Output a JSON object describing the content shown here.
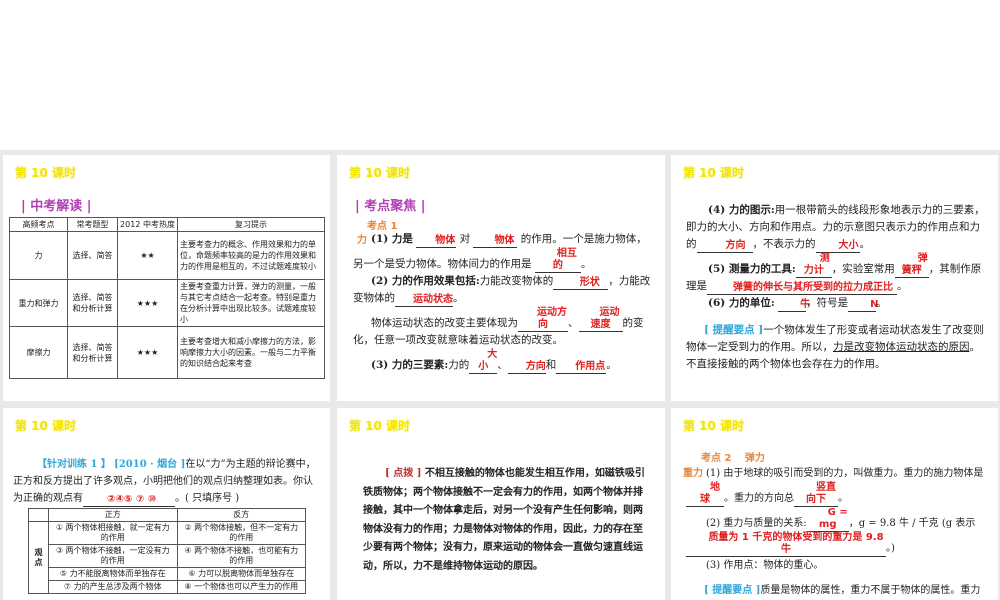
{
  "lesson_title": "第 10 课时",
  "slide1": {
    "section": "| 中考解读 |",
    "headers": [
      "高频考点",
      "常考题型",
      "2012 中考热度",
      "复习提示"
    ],
    "rows": [
      [
        "力",
        "选择、简答",
        "★★",
        "主要考查力的概念、作用效果和力的单位，命题频率较高的是力的作用效果和力的作用是相互的，不过试题难度较小"
      ],
      [
        "重力和弹力",
        "选择、简答和分析计算",
        "★★★",
        "主要考查重力计算，弹力的测量，一般与其它考点结合一起考查。特别是重力在分析计算中出现比较多。试题难度较小"
      ],
      [
        "摩擦力",
        "选择、简答和分析计算",
        "★★★",
        "主要考查增大和减小摩擦力的方法，影响摩擦力大小的因素。一般与二力平衡的知识结合起来考查"
      ]
    ]
  },
  "slide2": {
    "section": "| 考点聚焦 |",
    "point": "考点 1",
    "point_tag": "力",
    "p1a": "(1) 力是",
    "a1": "物体",
    "p1b": "对",
    "a2": "物体",
    "p1c": "的作用。一个是施力物体，另一个是受力物体。物体间力的作用是",
    "a3": "相互的",
    "end": "。",
    "p2a": "(2) 力的作用效果包括:",
    "p2b": "力能改变物体的",
    "a4": "形状",
    "p2c": "，力能改变物体的",
    "a5": "运动状态",
    "p3a": "物体运动状态的改变主要体现为",
    "a6": "运动方向",
    "sep": "、",
    "a7": "运动速度",
    "p3b": "的变化，任意一项改变就意味着运动状态的改变。",
    "p4a": "(3) 力的三要素:",
    "p4b": "力的",
    "a8": "大小",
    "a9": "方向",
    "p4c": "和",
    "a10": "作用点"
  },
  "slide3": {
    "p1a": "(4) 力的图示:",
    "p1b": "用一根带箭头的线段形象地表示力的三要素，即力的大小、方向和作用点。力的示意图只表示力的作用点和力的",
    "a1": "方向",
    "p1c": "，不表示力的",
    "a2": "大小",
    "p2a": "(5) 测量力的工具:",
    "a3": "测力计",
    "p2b": "，实验室常用",
    "a4": "弹簧秤",
    "p2c": "，其制作原理是",
    "a5": "弹簧的伸长与其所受到的拉力成正比",
    "p3a": "(6) 力的单位:",
    "a6": "牛",
    "p3b": "，符号是",
    "a7": "N",
    "tip_label": "[ 提醒要点 ]",
    "tip_a": "一个物体发生了形变或者运动状态发生了改变则物体一定受到力的作用。所以，",
    "tip_ul": "力是改变物体运动状态的原因",
    "tip_b": "。不直接接触的两个物体也会存在力的作用。"
  },
  "slide4": {
    "label": "【针对训练 1 】",
    "source": "[2010 · 烟台 ]",
    "q": "在以“力”为主题的辩论赛中，正方和反方提出了许多观点，小明把他们的观点归纳整理如表。你认为正确的观点有",
    "answer": "②④⑤ ⑦ ⑩",
    "q_end": "。( 只填序号 )",
    "col_pro": "正方",
    "col_con": "反方",
    "row_label": "观点",
    "rows": [
      [
        "① 两个物体相接触，就一定有力的作用",
        "② 两个物体接触，但不一定有力的作用"
      ],
      [
        "③ 两个物体不接触，一定没有力的作用",
        "④ 两个物体不接触，也可能有力的作用"
      ],
      [
        "⑤ 力不能脱离物体而单独存在",
        "⑥ 力可以脱离物体而单独存在"
      ],
      [
        "⑦ 力的产生总涉及两个物体",
        "⑧ 一个物体也可以产生力的作用"
      ]
    ]
  },
  "slide5": {
    "label": "[ 点拨 ]",
    "text": "不相互接触的物体也能发生相互作用，如磁铁吸引铁质物体；两个物体接触不一定会有力的作用，如两个物体并排接触，其中一个物体拿走后，对另一个没有产生任何影响，则两物体没有力的作用；力是物体对物体的作用，因此，力的存在至少要有两个物体；没有力，原来运动的物体会一直做匀速直线运动，所以，力不是维持物体运动的原因。"
  },
  "slide6": {
    "point": "考点 2　 弹力",
    "point_tag": "重力",
    "p1a": "(1) 由于地球的吸引而受到的力，叫做重力。重力的施力物体是",
    "a1": "地球",
    "p1b": "。重力的方向总",
    "a2": "竖直向下",
    "end": "。",
    "p2a": "(2) 重力与质量的关系:",
    "a3": "G = mg",
    "p2b": "，g = 9.8 牛 / 千克 (g 表示",
    "a4": "质量为 1 千克的物体受到的重力是 9.8 牛",
    "p2c": "。)",
    "p3": "(3) 作用点：物体的重心。",
    "tip_label": "[ 提醒要点 ]",
    "tip": "质量是物体的属性，重力不属于物体的属性。重力与质量成正比，但质量不与重力成正比。"
  }
}
